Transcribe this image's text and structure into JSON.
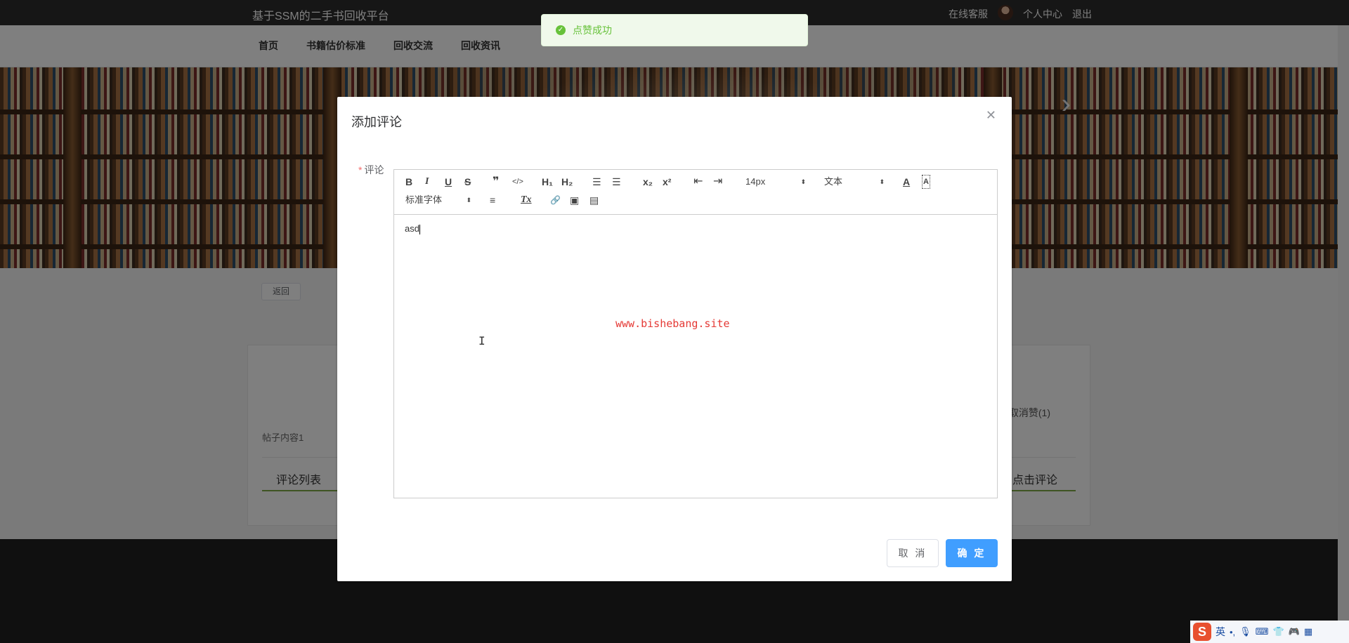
{
  "header": {
    "site_title": "基于SSM的二手书回收平台",
    "links": [
      "在线客服",
      "个人中心",
      "退出"
    ]
  },
  "nav": {
    "items": [
      "首页",
      "书籍估价标准",
      "回收交流",
      "回收资讯"
    ]
  },
  "page": {
    "back_label": "返回",
    "post_content": "帖子内容1",
    "cancel_like": "取消赞(1)",
    "tab_comments": "评论列表",
    "tab_click_comment": "点击评论"
  },
  "toast": {
    "message": "点赞成功",
    "icon": "check-icon"
  },
  "dialog": {
    "title": "添加评论",
    "close_icon": "close-icon",
    "field_label": "评论",
    "required_mark": "*",
    "editor_text": "asd",
    "watermark": "www.bishebang.site",
    "cancel_label": "取 消",
    "confirm_label": "确 定",
    "accent_color": "#409eff"
  },
  "toolbar": {
    "bold": "B",
    "italic": "I",
    "underline": "U",
    "strike": "S",
    "blockquote": "❞",
    "code": "</>",
    "h1": "H₁",
    "h2": "H₂",
    "ordered_list": "☰",
    "bullet_list": "☰",
    "subscript": "x₂",
    "superscript": "x²",
    "outdent": "⇤",
    "indent": "⇥",
    "size_select": "14px",
    "header_select": "文本",
    "font_color": "A",
    "bg_color": "A",
    "font_select": "标准字体",
    "align": "≡",
    "clean": "Tx",
    "link": "🔗",
    "image": "▣",
    "video": "▤"
  },
  "ime": {
    "logo": "S",
    "mode": "英",
    "icons": [
      "punctuation-icon",
      "mic-icon",
      "keyboard-icon",
      "skin-icon",
      "game-icon",
      "toolbox-icon"
    ]
  }
}
